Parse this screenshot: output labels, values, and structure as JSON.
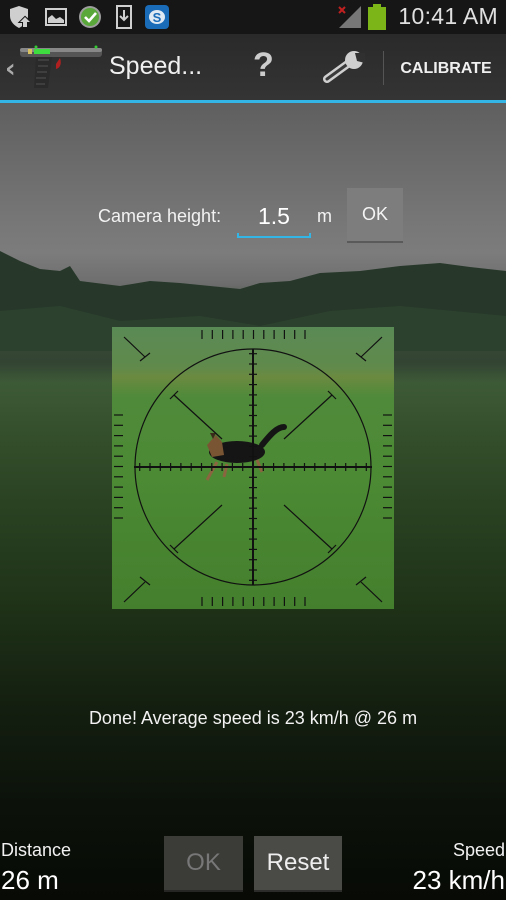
{
  "status_bar": {
    "notification_icons": [
      "security-update-icon",
      "image-icon",
      "check-circle-icon",
      "download-icon",
      "skype-icon"
    ],
    "signal": "no-signal-icon",
    "battery_color": "#7cb518",
    "time": "10:41 AM"
  },
  "action_bar": {
    "back_glyph": "‹",
    "app_icon": "speed-gun-icon",
    "title": "Speed...",
    "help_glyph": "?",
    "settings_icon": "wrench-icon",
    "calibrate_label": "CALIBRATE",
    "accent_color": "#33b5e5"
  },
  "camera_height": {
    "label": "Camera height:",
    "value": "1.5",
    "unit": "m",
    "ok_label": "OK"
  },
  "viewfinder": {
    "subject": "dog running in meadow",
    "reticle": "crosshair-reticle"
  },
  "result": {
    "message": "Done! Average speed is 23 km/h @ 26 m"
  },
  "bottom": {
    "distance_label": "Distance",
    "distance_value": "26 m",
    "ok_label": "OK",
    "reset_label": "Reset",
    "speed_label": "Speed",
    "speed_value": "23 km/h"
  }
}
